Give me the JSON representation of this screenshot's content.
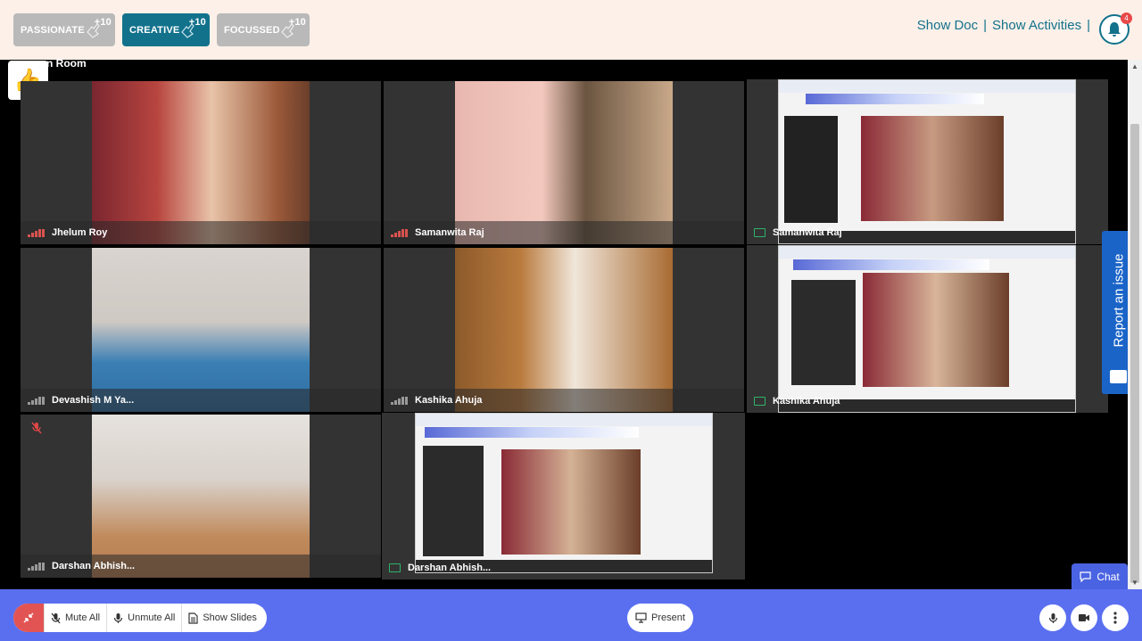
{
  "badges": [
    {
      "label": "PASSIONATE",
      "count": "+10",
      "active": false
    },
    {
      "label": "CREATIVE",
      "count": "+10",
      "active": true
    },
    {
      "label": "FOCUSSED",
      "count": "+10",
      "active": false
    }
  ],
  "header": {
    "show_doc": "Show Doc",
    "separator": "|",
    "show_activities": "Show Activities",
    "notification_count": "4"
  },
  "room": {
    "label": "n Room",
    "reaction_icon": "thumbs-up-icon"
  },
  "participants": [
    {
      "name": "Jhelum Roy",
      "indicator": "signal-red"
    },
    {
      "name": "Samanwita Raj",
      "indicator": "signal-red"
    },
    {
      "name": "Samanwita Raj",
      "indicator": "screen-share"
    },
    {
      "name": "Devashish M Ya...",
      "indicator": "signal"
    },
    {
      "name": "Kashika Ahuja",
      "indicator": "signal"
    },
    {
      "name": "Kashika Ahuja",
      "indicator": "screen-share"
    },
    {
      "name": "Darshan Abhish...",
      "indicator": "signal",
      "muted": true
    },
    {
      "name": "Darshan Abhish...",
      "indicator": "screen-share"
    }
  ],
  "report": {
    "label": "Report an issue"
  },
  "chat": {
    "label": "Chat"
  },
  "controls": {
    "mute_all": "Mute All",
    "unmute_all": "Unmute All",
    "show_slides": "Show Slides",
    "present": "Present"
  },
  "colors": {
    "accent": "#12728c",
    "bar": "#5a6ff0",
    "report": "#1a64c8",
    "alert": "#e25454"
  }
}
